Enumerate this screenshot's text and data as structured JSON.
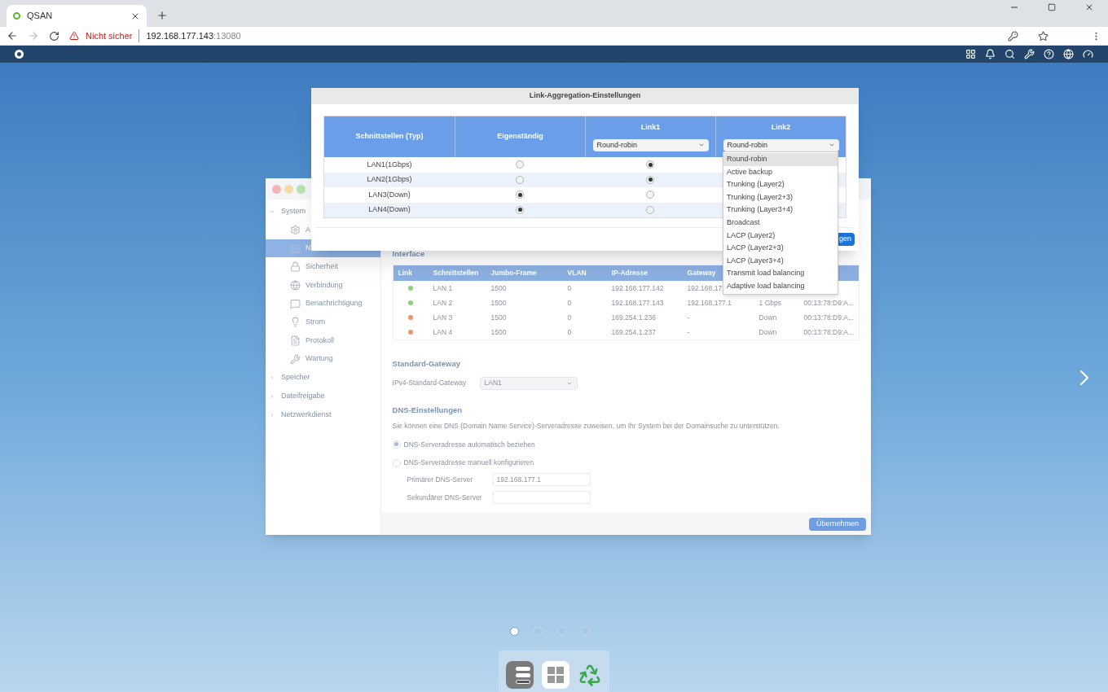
{
  "browser": {
    "tab": {
      "title": "QSAN"
    },
    "security": "Nicht sicher",
    "url_host": "192.168.177.143",
    "url_port": ":13080"
  },
  "settings_window": {
    "sidebar": [
      {
        "label": "System",
        "expanded": true,
        "children": [
          {
            "label": "A",
            "selected": false
          },
          {
            "label": "N",
            "selected": true
          },
          {
            "label": "Sicherheit",
            "selected": false
          },
          {
            "label": "Verbindung",
            "selected": false
          },
          {
            "label": "Benachrichtigung",
            "selected": false
          },
          {
            "label": "Strom",
            "selected": false
          },
          {
            "label": "Protokoll",
            "selected": false
          },
          {
            "label": "Wartung",
            "selected": false
          }
        ]
      },
      {
        "label": "Speicher",
        "expanded": false
      },
      {
        "label": "Dateifreigabe",
        "expanded": false
      },
      {
        "label": "Netzwerkdienst",
        "expanded": false
      }
    ],
    "interface": {
      "title": "Interface",
      "link_column": "Link",
      "columns": [
        "Schnittstellen",
        "Jumbo-Frame",
        "VLAN",
        "IP-Adresse",
        "Gateway",
        null,
        null
      ],
      "rows": [
        {
          "color": "#8fd17a",
          "cells": [
            "LAN 1",
            "1500",
            "0",
            "192.168.177.142",
            "192.168.17",
            null,
            null
          ]
        },
        {
          "color": "#8fd17a",
          "cells": [
            "LAN 2",
            "1500",
            "0",
            "192.168.177.143",
            "192.168.177.1",
            "1 Gbps",
            "00:13:78:D9:A..."
          ]
        },
        {
          "color": "#f0926a",
          "cells": [
            "LAN 3",
            "1500",
            "0",
            "169.254.1.236",
            "-",
            "Down",
            "00:13:78:D9:A..."
          ]
        },
        {
          "color": "#f0926a",
          "cells": [
            "LAN 4",
            "1500",
            "0",
            "169.254.1.237",
            "-",
            "Down",
            "00:13:78:D9:A..."
          ]
        }
      ]
    },
    "gateway": {
      "title": "Standard-Gateway",
      "label": "IPv4-Standard-Gateway",
      "value": "LAN1"
    },
    "dns": {
      "title": "DNS-Einstellungen",
      "description": "Sie können eine DNS (Domain Name Service)-Serveradresse zuweisen, um Ihr System bei der Domainsuche zu unterstützen.",
      "options": [
        {
          "label": "DNS-Serveradresse automatisch beziehen",
          "selected": true
        },
        {
          "label": "DNS-Serveradresse manuell konfigurieren",
          "selected": false
        }
      ],
      "fields": [
        {
          "label": "Primärer DNS-Server",
          "placeholder": "192.168.177.1"
        },
        {
          "label": "Sekundärer DNS-Server"
        }
      ]
    },
    "apply_button": "Übernehmen"
  },
  "dialog": {
    "title": "Link-Aggregation-Einstellungen",
    "columns": [
      {
        "label": "Schnittstellen (Typ)"
      },
      {
        "label": "Eigenständig"
      },
      {
        "label": "Link1",
        "mode": "Round-robin"
      },
      {
        "label": "Link2",
        "mode": "Round-robin"
      }
    ],
    "rows": [
      {
        "name": "LAN1(1Gbps)",
        "standalone": false,
        "link1": true
      },
      {
        "name": "LAN2(1Gbps)",
        "standalone": false,
        "link1": true
      },
      {
        "name": "LAN3(Down)",
        "standalone": true,
        "link1": false
      },
      {
        "name": "LAN4(Down)",
        "standalone": true,
        "link1": false
      }
    ],
    "button": "gen",
    "dropdown": {
      "options": [
        {
          "label": "Round-robin",
          "selected": true
        },
        {
          "label": "Active backup",
          "selected": false
        },
        {
          "label": "Trunking (Layer2)",
          "selected": false
        },
        {
          "label": "Trunking (Layer2+3)",
          "selected": false
        },
        {
          "label": "Trunking (Layer3+4)",
          "selected": false
        },
        {
          "label": "Broadcast",
          "selected": false
        },
        {
          "label": "LACP (Layer2)",
          "selected": false
        },
        {
          "label": "LACP (Layer2+3)",
          "selected": false
        },
        {
          "label": "LACP (Layer3+4)",
          "selected": false
        },
        {
          "label": "Transmit load balancing",
          "selected": false
        },
        {
          "label": "Adaptive load balancing",
          "selected": false
        }
      ]
    }
  },
  "pager": [
    {
      "selected": true
    },
    {
      "selected": false
    },
    {
      "selected": false
    },
    {
      "selected": false
    }
  ]
}
